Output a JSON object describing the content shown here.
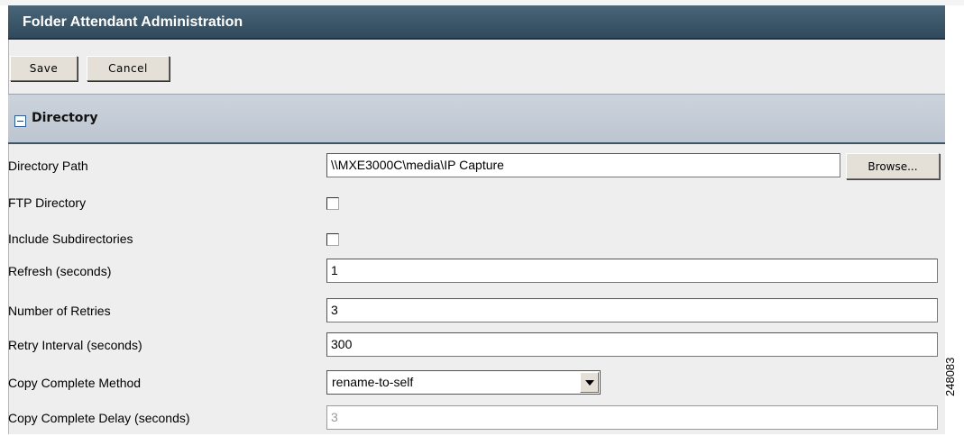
{
  "window": {
    "title": "Folder Attendant Administration"
  },
  "toolbar": {
    "save_label": "Save",
    "cancel_label": "Cancel"
  },
  "section": {
    "title": "Directory",
    "expanded": true
  },
  "fields": {
    "directory_path": {
      "label": "Directory Path",
      "value": "\\\\MXE3000C\\media\\IP Capture",
      "browse_label": "Browse..."
    },
    "ftp_directory": {
      "label": "FTP Directory",
      "checked": false
    },
    "include_subdirectories": {
      "label": "Include Subdirectories",
      "checked": false
    },
    "refresh_seconds": {
      "label": "Refresh (seconds)",
      "value": "1"
    },
    "number_of_retries": {
      "label": "Number of Retries",
      "value": "3"
    },
    "retry_interval": {
      "label": "Retry Interval (seconds)",
      "value": "300"
    },
    "copy_complete_method": {
      "label": "Copy Complete Method",
      "value": "rename-to-self"
    },
    "copy_complete_delay": {
      "label": "Copy Complete Delay (seconds)",
      "value": "3",
      "disabled": true
    }
  },
  "figure_number": "248083",
  "colors": {
    "title_bar": "#3a5466",
    "section_header": "#c4ccd6",
    "panel_background": "#eeeeee",
    "button_face": "#e4e0d8"
  },
  "icons": {
    "section_toggle": "collapse-minus-icon",
    "dropdown": "dropdown-arrow-icon"
  }
}
